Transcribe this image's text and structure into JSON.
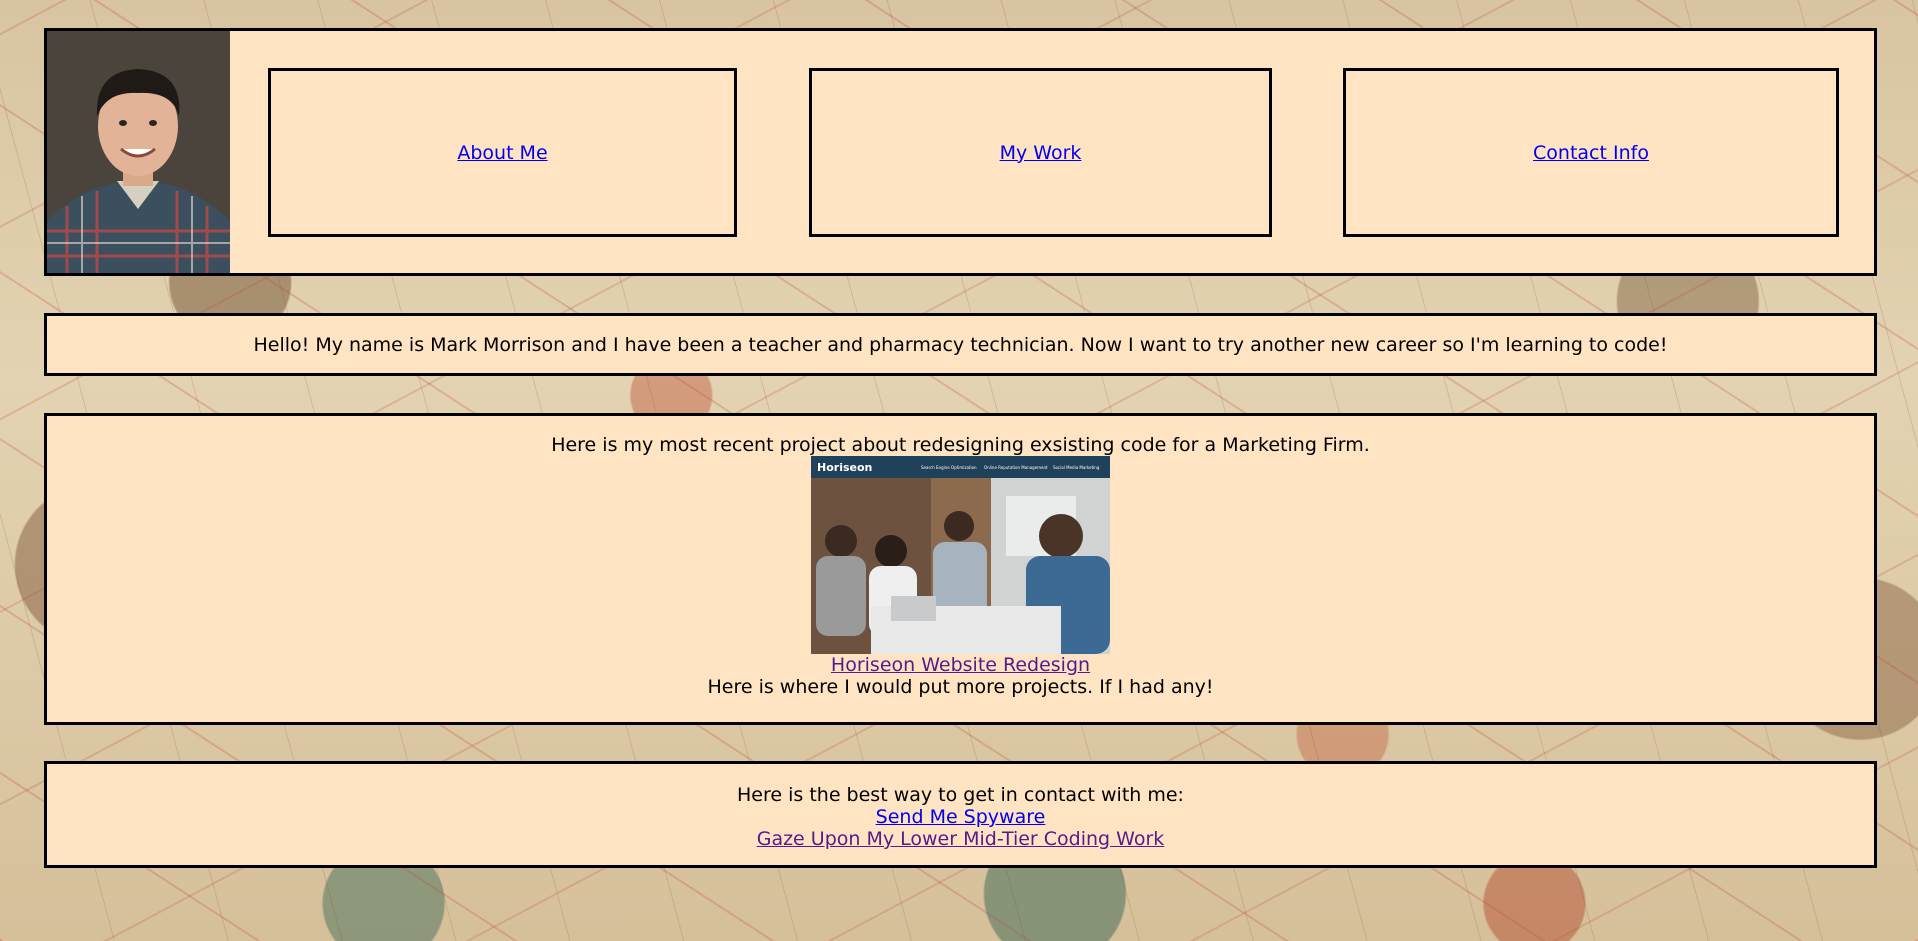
{
  "nav": {
    "about_label": "About Me",
    "work_label": "My Work",
    "contact_label": "Contact Info"
  },
  "about": {
    "text": "Hello! My name is Mark Morrison and I have been a teacher and pharmacy technician. Now I want to try another new career so I'm learning to code!"
  },
  "work": {
    "intro": "Here is my most recent project about redesigning exsisting code for a Marketing Firm.",
    "project_thumbnail": {
      "brand": "Horiseon",
      "menu": [
        "Search Engine Optimization",
        "Online Reputation Management",
        "Social Media Marketing"
      ]
    },
    "project_link": "Horiseon Website Redesign",
    "more_text": "Here is where I would put more projects. If I had any!"
  },
  "contact": {
    "intro": "Here is the best way to get in contact with me:",
    "email_link": "Send Me Spyware",
    "github_link": "Gaze Upon My Lower Mid-Tier Coding Work"
  },
  "colors": {
    "panel_background": "#ffe4c4",
    "link": "#0000ee",
    "visited_link": "#551a8b",
    "border": "#000000"
  }
}
